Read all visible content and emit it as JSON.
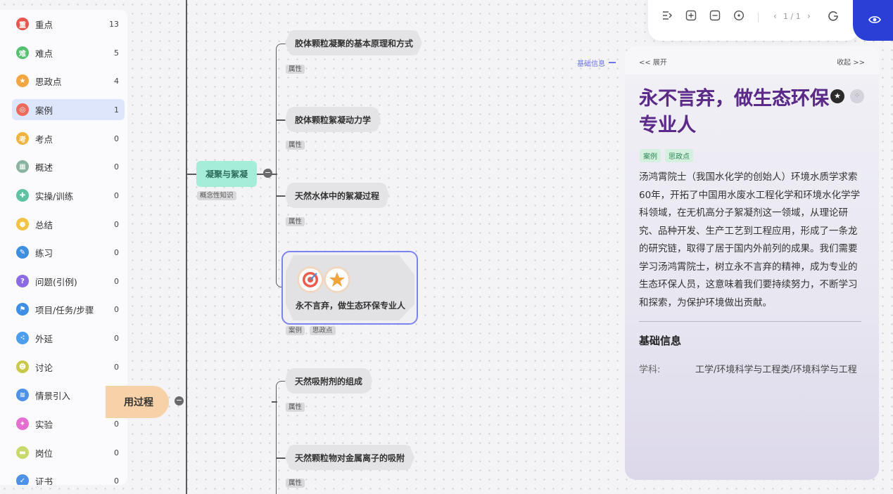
{
  "sidebar": {
    "items": [
      {
        "label": "重点",
        "count": "13",
        "glyph": "重",
        "color": "#e8554e",
        "icon": "key-point-icon"
      },
      {
        "label": "难点",
        "count": "5",
        "glyph": "难",
        "color": "#56c271",
        "icon": "difficulty-icon"
      },
      {
        "label": "思政点",
        "count": "4",
        "glyph": "★",
        "color": "#f2a541",
        "icon": "star-icon"
      },
      {
        "label": "案例",
        "count": "1",
        "glyph": "◎",
        "color": "#ef6a5d",
        "icon": "target-icon"
      },
      {
        "label": "考点",
        "count": "0",
        "glyph": "考",
        "color": "#f2b441",
        "icon": "exam-icon"
      },
      {
        "label": "概述",
        "count": "0",
        "glyph": "▦",
        "color": "#8bb4a0",
        "icon": "overview-icon"
      },
      {
        "label": "实操/训练",
        "count": "0",
        "glyph": "✚",
        "color": "#5fc2a2",
        "icon": "practice-icon"
      },
      {
        "label": "总结",
        "count": "0",
        "glyph": "●",
        "color": "#f5c343",
        "icon": "bulb-icon"
      },
      {
        "label": "练习",
        "count": "0",
        "glyph": "✎",
        "color": "#3f8fe0",
        "icon": "pen-icon"
      },
      {
        "label": "问题(引例)",
        "count": "0",
        "glyph": "?",
        "color": "#8c6ae6",
        "icon": "question-icon"
      },
      {
        "label": "项目/任务/步骤",
        "count": "0",
        "glyph": "⚑",
        "color": "#3e8fe8",
        "icon": "project-icon"
      },
      {
        "label": "外延",
        "count": "0",
        "glyph": "⁖",
        "color": "#4d9ef0",
        "icon": "extension-icon"
      },
      {
        "label": "讨论",
        "count": "0",
        "glyph": "☻",
        "color": "#c9c84a",
        "icon": "discussion-icon"
      },
      {
        "label": "情景引入",
        "count": "0",
        "glyph": "≋",
        "color": "#4d92e8",
        "icon": "scene-icon"
      },
      {
        "label": "实验",
        "count": "0",
        "glyph": "✦",
        "color": "#e46fd0",
        "icon": "experiment-icon"
      },
      {
        "label": "岗位",
        "count": "0",
        "glyph": "▬",
        "color": "#c9d86a",
        "icon": "job-icon"
      },
      {
        "label": "证书",
        "count": "0",
        "glyph": "✓",
        "color": "#4d92e8",
        "icon": "certificate-icon"
      }
    ]
  },
  "mindmap": {
    "partial_node": "用过程",
    "branch_node": "凝聚与絮凝",
    "branch_tag": "概念性知识",
    "topics": [
      {
        "label": "胶体颗粒凝聚的基本原理和方式",
        "tags": [
          "属性"
        ]
      },
      {
        "label": "胶体颗粒絮凝动力学",
        "tags": [
          "属性"
        ]
      },
      {
        "label": "天然水体中的絮凝过程",
        "tags": [
          "属性"
        ]
      },
      {
        "label": "永不言弃，做生态环保专业人",
        "tags": [
          "案例",
          "思政点"
        ]
      },
      {
        "label": "天然吸附剂的组成",
        "tags": [
          "属性"
        ]
      },
      {
        "label": "天然颗粒物对金属离子的吸附",
        "tags": [
          "属性"
        ]
      }
    ],
    "side_link": "基础信息"
  },
  "toolbar": {
    "page_indicator": "1 / 1"
  },
  "panel": {
    "expand": "<< 展开",
    "collapse": "收起 >>",
    "title": "永不言弃，做生态环保专业人",
    "tags": [
      "案例",
      "思政点"
    ],
    "body": "汤鸿霄院士（我国水化学的创始人）环境水质学求索60年，开拓了中国用水废水工程化学和环境水化学学科领域，在无机高分子絮凝剂这一领域，从理论研究、品种开发、生产工艺到工程应用，形成了一条龙的研究链，取得了居于国内外前列的成果。我们需要学习汤鸿霄院士，树立永不言弃的精神，成为专业的生态环保人员，这意味着我们要持续努力，不断学习和探索，为保护环境做出贡献。",
    "section_title": "基础信息",
    "field_label": "学科:",
    "field_value": "工学/环境科学与工程类/环境科学与工程"
  }
}
